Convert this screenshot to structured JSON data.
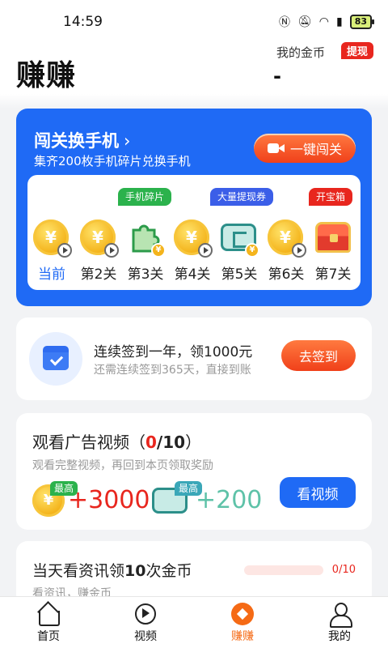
{
  "status": {
    "time": "14:59",
    "battery": "83"
  },
  "header": {
    "title": "赚赚",
    "coin_label": "我的金币",
    "withdraw": "提现",
    "coin_value": "-"
  },
  "challenge": {
    "title": "闯关换手机",
    "chevron": "›",
    "subtitle": "集齐200枚手机碎片兑换手机",
    "button": "一键闯关",
    "tags": {
      "phone_piece": "手机碎片",
      "cash_ticket": "大量提现券",
      "chest": "开宝箱"
    },
    "levels": [
      {
        "label": "当前",
        "icon": "coin-play-icon",
        "current": true
      },
      {
        "label": "第2关",
        "icon": "coin-play-icon"
      },
      {
        "label": "第3关",
        "icon": "puzzle-piece-icon"
      },
      {
        "label": "第4关",
        "icon": "coin-play-icon"
      },
      {
        "label": "第5关",
        "icon": "cash-ticket-icon"
      },
      {
        "label": "第6关",
        "icon": "coin-play-icon"
      },
      {
        "label": "第7关",
        "icon": "treasure-chest-icon"
      }
    ]
  },
  "signin": {
    "title": "连续签到一年，领1000元",
    "subtitle": "还需连续签到365天，直接到账",
    "button": "去签到"
  },
  "video_task": {
    "title_prefix": "观看广告视频（",
    "current": "0",
    "total": "/10",
    "title_suffix": "）",
    "subtitle": "观看完整视频，再回到本页领取奖励",
    "reward_coin": {
      "badge": "最高",
      "amount": "+3000"
    },
    "reward_ticket": {
      "badge": "最高",
      "amount": "+200"
    },
    "button": "看视频"
  },
  "news_task": {
    "title_prefix": "当天看资讯领",
    "title_count": "10",
    "title_suffix": "次金币",
    "subtitle": "看资讯，赚金币",
    "progress_text": "0/10",
    "progress": 0
  },
  "tabbar": [
    {
      "label": "首页",
      "icon": "home-icon"
    },
    {
      "label": "视频",
      "icon": "video-icon"
    },
    {
      "label": "赚赚",
      "icon": "earn-icon",
      "active": true
    },
    {
      "label": "我的",
      "icon": "profile-icon"
    }
  ],
  "colors": {
    "primary_blue": "#1f6af5",
    "accent_orange": "#f56a15",
    "red": "#e8261e",
    "gold": "#f4b41c"
  }
}
